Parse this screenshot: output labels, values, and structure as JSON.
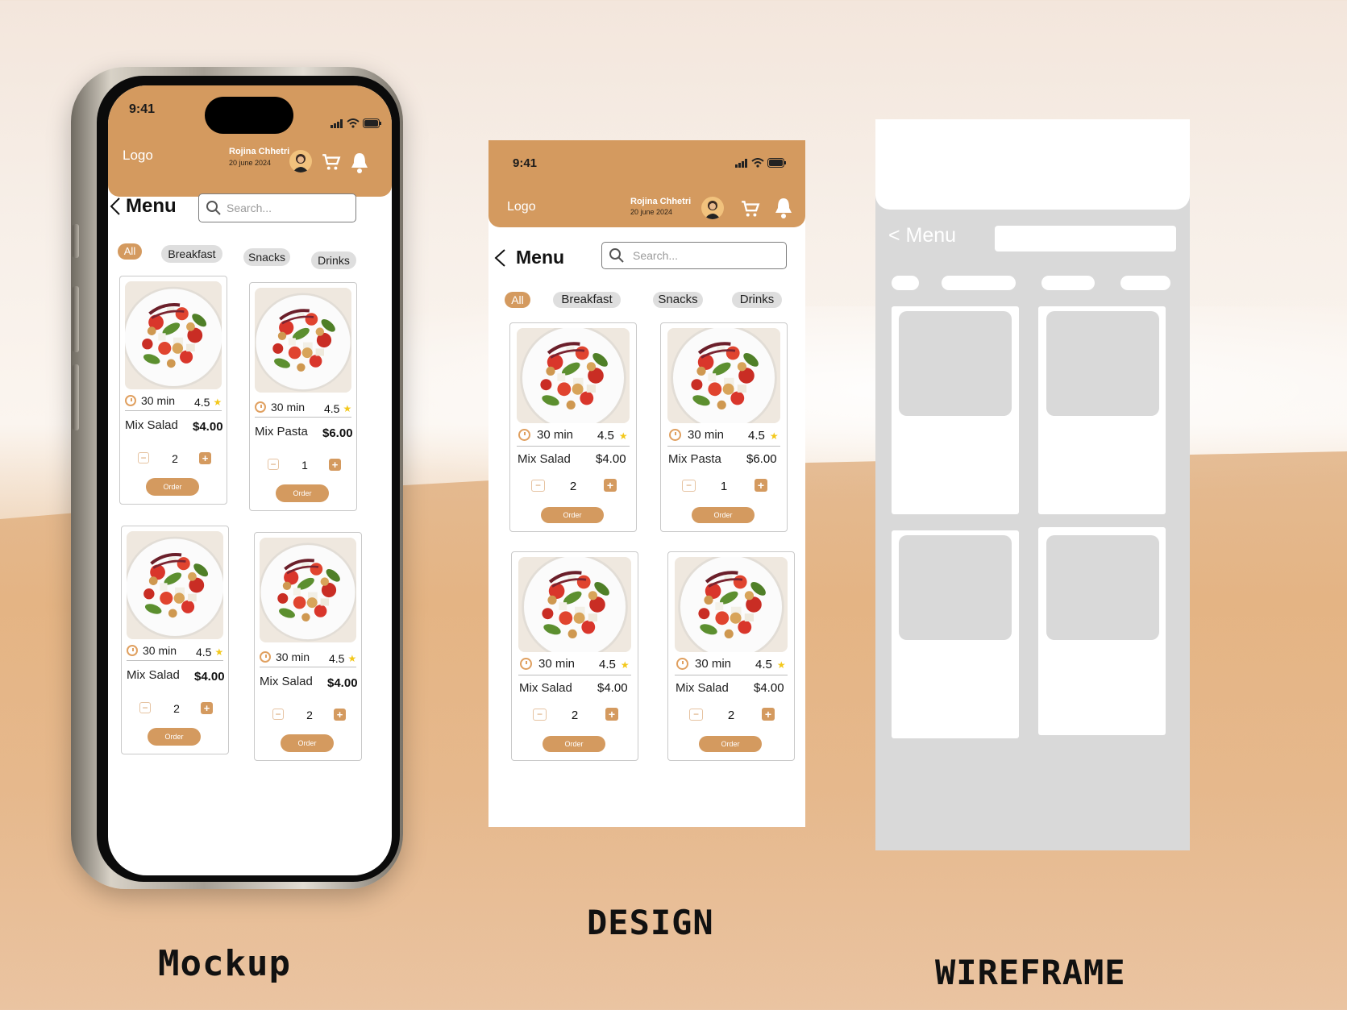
{
  "status": {
    "time": "9:41"
  },
  "header": {
    "logo": "Logo",
    "user_name": "Rojina Chhetri",
    "user_date": "20 june 2024"
  },
  "nav": {
    "title": "Menu",
    "search_placeholder": "Search..."
  },
  "categories": [
    {
      "label": "All",
      "active": true
    },
    {
      "label": "Breakfast",
      "active": false
    },
    {
      "label": "Snacks",
      "active": false
    },
    {
      "label": "Drinks",
      "active": false
    }
  ],
  "items": [
    {
      "time": "30 min",
      "rating": "4.5",
      "name": "Mix Salad",
      "price": "$4.00",
      "qty": "2",
      "order": "Order"
    },
    {
      "time": "30 min",
      "rating": "4.5",
      "name": "Mix Pasta",
      "price": "$6.00",
      "qty": "1",
      "order": "Order"
    },
    {
      "time": "30 min",
      "rating": "4.5",
      "name": "Mix Salad",
      "price": "$4.00",
      "qty": "2",
      "order": "Order"
    },
    {
      "time": "30 min",
      "rating": "4.5",
      "name": "Mix Salad",
      "price": "$4.00",
      "qty": "2",
      "order": "Order"
    }
  ],
  "wireframe": {
    "title": "Menu"
  },
  "captions": {
    "mockup": "Mockup",
    "design": "DESIGN",
    "wireframe": "WIREFRAME"
  },
  "colors": {
    "accent": "#d49a5f",
    "wireframe_gray": "#d9d9d9"
  }
}
